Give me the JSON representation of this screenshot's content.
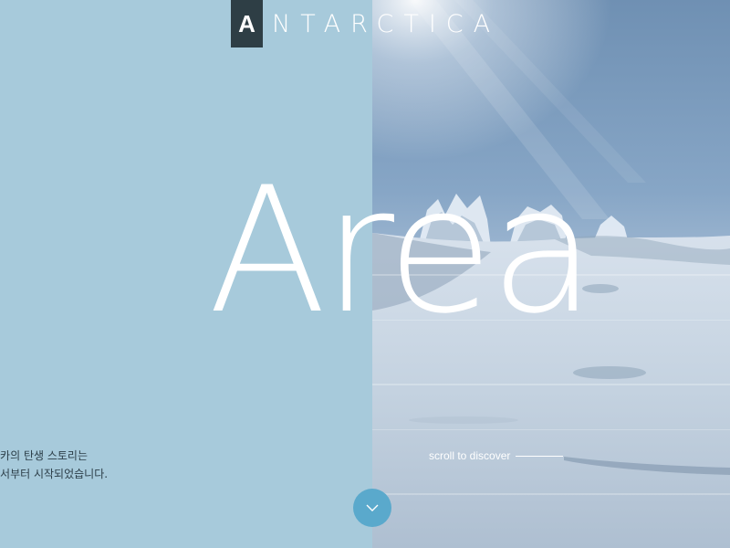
{
  "brand": {
    "logo_initial": "A",
    "logo_rest": "NTARCTICA"
  },
  "hero": {
    "word": "Area"
  },
  "intro": {
    "line1": "|카의 탄생 스토리는",
    "line2": "|서부터 시작되었습니다."
  },
  "scroll": {
    "label": "scroll to discover",
    "button_icon": "chevron-down-icon"
  },
  "colors": {
    "panel": "#a7cadb",
    "logo_box": "#2e3e45",
    "accent": "#5aa9cc",
    "text_dark": "#2c3e48"
  }
}
